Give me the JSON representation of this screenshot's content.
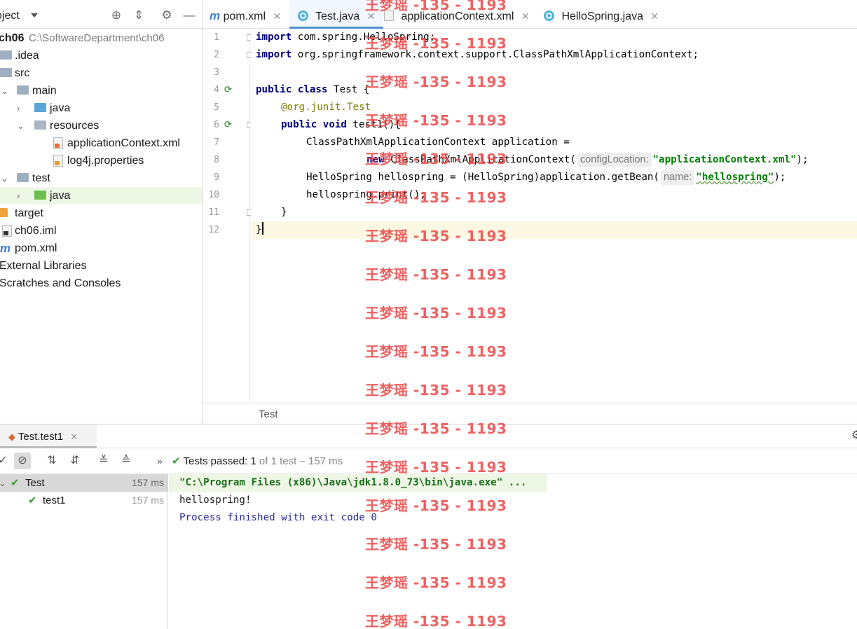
{
  "project_panel": {
    "title": "oject",
    "tree": [
      {
        "label": "ch06",
        "path": "C:\\SoftwareDepartment\\ch06",
        "type": "module"
      },
      {
        "label": ".idea",
        "type": "folder"
      },
      {
        "label": "src",
        "type": "folder"
      },
      {
        "label": "main",
        "type": "folder"
      },
      {
        "label": "java",
        "type": "source-folder"
      },
      {
        "label": "resources",
        "type": "resource-folder"
      },
      {
        "label": "applicationContext.xml",
        "type": "xml-file"
      },
      {
        "label": "log4j.properties",
        "type": "properties-file"
      },
      {
        "label": "test",
        "type": "folder"
      },
      {
        "label": "java",
        "type": "test-source-folder"
      },
      {
        "label": "target",
        "type": "excluded-folder"
      },
      {
        "label": "ch06.iml",
        "type": "iml-file"
      },
      {
        "label": "pom.xml",
        "type": "maven-file"
      },
      {
        "label": "External Libraries",
        "type": "libraries"
      },
      {
        "label": "Scratches and Consoles",
        "type": "scratches"
      }
    ]
  },
  "editor": {
    "tabs": [
      {
        "label": "pom.xml",
        "icon": "maven-icon"
      },
      {
        "label": "Test.java",
        "icon": "java-test-class-icon",
        "active": true
      },
      {
        "label": "applicationContext.xml",
        "icon": "spring-xml-icon"
      },
      {
        "label": "HelloSpring.java",
        "icon": "java-class-icon"
      }
    ],
    "line_numbers": [
      "1",
      "2",
      "3",
      "4",
      "5",
      "6",
      "7",
      "8",
      "9",
      "10",
      "11",
      "12"
    ],
    "code": {
      "l1_kw": "import",
      "l1_rest": " com.spring.HelloSpring;",
      "l2_kw": "import",
      "l2_rest": " org.springframework.context.support.ClassPathXmlApplicationContext;",
      "l4_kw": "public class",
      "l4_rest": " Test {",
      "l5_ann": "@org.junit.Test",
      "l6_kw": "public void",
      "l6_rest": " test1(){",
      "l7": "ClassPathXmlApplicationContext application =",
      "l8_kw": "new",
      "l8_mid": " ClassPathXmlApplicationContext(",
      "l8_hint": "configLocation:",
      "l8_str": "\"applicationContext.xml\"",
      "l8_end": ");",
      "l9_pre": "HelloSpring hellospring = (HelloSpring)application.getBean(",
      "l9_hint": "name:",
      "l9_str": "\"hellospring\"",
      "l9_end": ");",
      "l10": "hellospring.print();",
      "l11": "}",
      "l12": "}"
    },
    "breadcrumb": "Test"
  },
  "run_panel": {
    "tab_label": "Test.test1",
    "status_prefix": "Tests passed:",
    "status_count": "1",
    "status_rest": "of 1 test – 157 ms",
    "tests": [
      {
        "label": "Test",
        "time": "157 ms"
      },
      {
        "label": "test1",
        "time": "157 ms"
      }
    ],
    "console": [
      "\"C:\\Program Files (x86)\\Java\\jdk1.8.0_73\\bin\\java.exe\" ...",
      "hellospring!",
      "Process finished with exit code 0"
    ]
  },
  "watermark": "王梦瑶 -135 - 1193",
  "colors": {
    "accent": "#4f8fd6",
    "pass": "#3b9c3b",
    "watermark": "#eb4646"
  }
}
